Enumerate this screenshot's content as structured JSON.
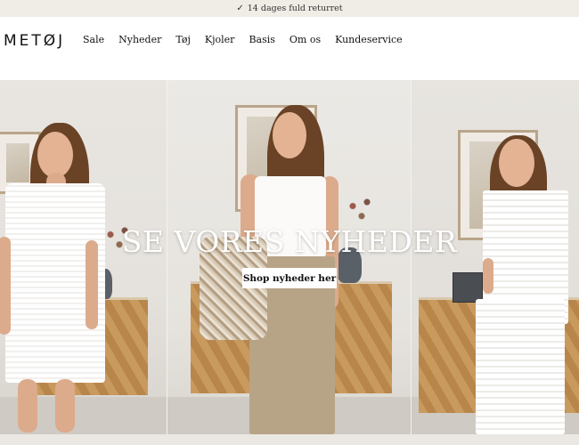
{
  "announcement": {
    "check_icon": "check-icon",
    "text": "14 dages fuld returret"
  },
  "header": {
    "logo": "METØJ",
    "nav": [
      {
        "label": "Sale"
      },
      {
        "label": "Nyheder"
      },
      {
        "label": "Tøj"
      },
      {
        "label": "Kjoler"
      },
      {
        "label": "Basis"
      },
      {
        "label": "Om os"
      },
      {
        "label": "Kundeservice"
      }
    ]
  },
  "hero": {
    "title": "SE VORES NYHEDER",
    "button_label": "Shop nyheder her"
  },
  "colors": {
    "announcement_bg": "#f0ece6",
    "button_bg": "#ffffff",
    "title_color": "#ffffff"
  }
}
